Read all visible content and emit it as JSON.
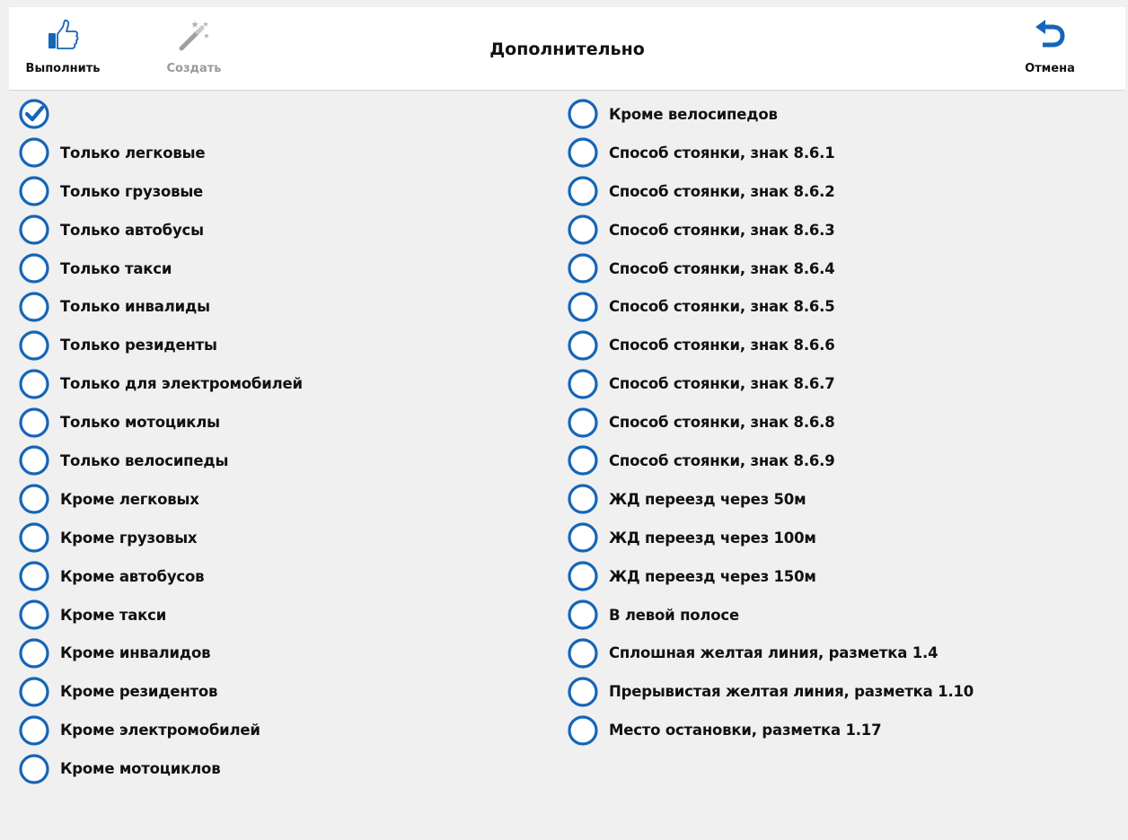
{
  "toolbar": {
    "execute_label": "Выполнить",
    "create_label": "Создать",
    "cancel_label": "Отмена",
    "title": "Дополнительно"
  },
  "colors": {
    "accent": "#1565b8",
    "disabled": "#9a9a9a",
    "background": "#f0f0f0"
  },
  "options_left": [
    {
      "label": "",
      "checked": true
    },
    {
      "label": "Только легковые",
      "checked": false
    },
    {
      "label": "Только грузовые",
      "checked": false
    },
    {
      "label": "Только автобусы",
      "checked": false
    },
    {
      "label": "Только такси",
      "checked": false
    },
    {
      "label": "Только инвалиды",
      "checked": false
    },
    {
      "label": "Только резиденты",
      "checked": false
    },
    {
      "label": "Только для электромобилей",
      "checked": false
    },
    {
      "label": "Только мотоциклы",
      "checked": false
    },
    {
      "label": "Только велосипеды",
      "checked": false
    },
    {
      "label": "Кроме легковых",
      "checked": false
    },
    {
      "label": "Кроме грузовых",
      "checked": false
    },
    {
      "label": "Кроме автобусов",
      "checked": false
    },
    {
      "label": "Кроме такси",
      "checked": false
    },
    {
      "label": "Кроме инвалидов",
      "checked": false
    },
    {
      "label": "Кроме резидентов",
      "checked": false
    },
    {
      "label": "Кроме электромобилей",
      "checked": false
    },
    {
      "label": "Кроме мотоциклов",
      "checked": false
    }
  ],
  "options_right": [
    {
      "label": "Кроме велосипедов",
      "checked": false
    },
    {
      "label": "Способ стоянки, знак 8.6.1",
      "checked": false
    },
    {
      "label": "Способ стоянки, знак 8.6.2",
      "checked": false
    },
    {
      "label": "Способ стоянки, знак 8.6.3",
      "checked": false
    },
    {
      "label": "Способ стоянки, знак 8.6.4",
      "checked": false
    },
    {
      "label": "Способ стоянки, знак 8.6.5",
      "checked": false
    },
    {
      "label": "Способ стоянки, знак 8.6.6",
      "checked": false
    },
    {
      "label": "Способ стоянки, знак 8.6.7",
      "checked": false
    },
    {
      "label": "Способ стоянки, знак 8.6.8",
      "checked": false
    },
    {
      "label": "Способ стоянки, знак 8.6.9",
      "checked": false
    },
    {
      "label": "ЖД переезд через 50м",
      "checked": false
    },
    {
      "label": "ЖД переезд через 100м",
      "checked": false
    },
    {
      "label": "ЖД переезд через 150м",
      "checked": false
    },
    {
      "label": "В левой полосе",
      "checked": false
    },
    {
      "label": "Сплошная желтая линия, разметка 1.4",
      "checked": false
    },
    {
      "label": "Прерывистая желтая линия, разметка 1.10",
      "checked": false
    },
    {
      "label": "Место остановки, разметка 1.17",
      "checked": false
    }
  ]
}
